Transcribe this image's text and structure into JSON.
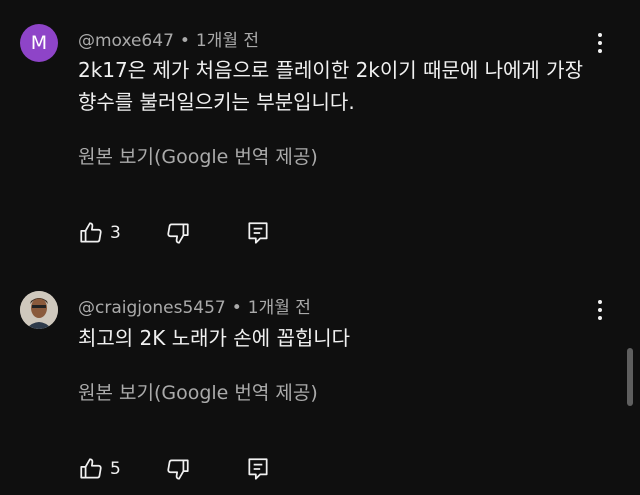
{
  "comments": [
    {
      "avatar_letter": "M",
      "author": "@moxe647",
      "separator": "•",
      "time": "1개월 전",
      "text": "2k17은 제가 처음으로 플레이한 2k이기 때문에 나에게 가장 향수를 불러일으키는 부분입니다.",
      "translate_label": "원본 보기(Google 번역 제공)",
      "like_count": "3",
      "avatar_color": "#8e44c8"
    },
    {
      "avatar_letter": "",
      "author": "@craigjones5457",
      "separator": "•",
      "time": "1개월 전",
      "text": "최고의 2K 노래가 손에 꼽힙니다",
      "translate_label": "원본 보기(Google 번역 제공)",
      "like_count": "5"
    }
  ],
  "icons": {
    "like": "thumb-up-icon",
    "dislike": "thumb-down-icon",
    "reply": "reply-icon",
    "menu": "more-vert-icon"
  },
  "colors": {
    "background": "#0f0f0f",
    "text_primary": "#f1f1f1",
    "text_secondary": "#aaaaaa"
  }
}
